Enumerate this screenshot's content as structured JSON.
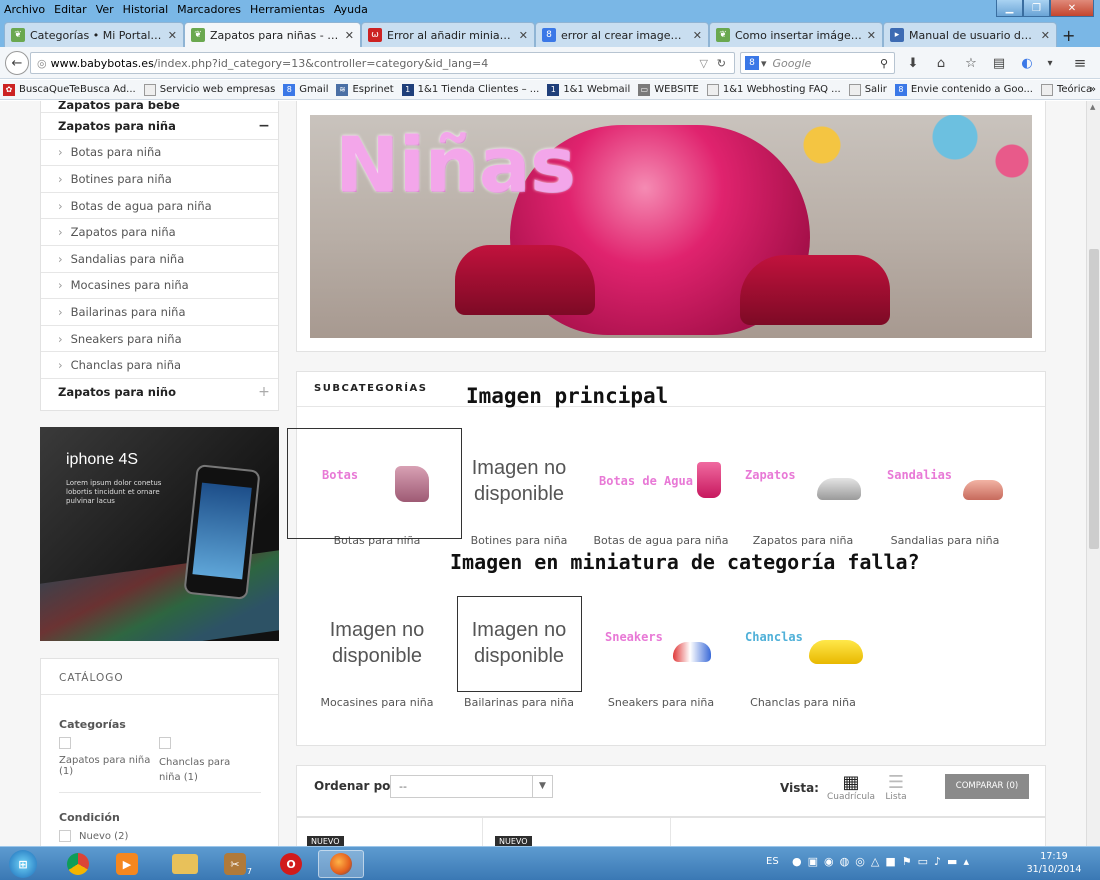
{
  "menubar": {
    "items": [
      "Archivo",
      "Editar",
      "Ver",
      "Historial",
      "Marcadores",
      "Herramientas",
      "Ayuda"
    ]
  },
  "tabs": [
    {
      "title": "Categorías • Mi Portal/C...",
      "favicon": "leaf-icon",
      "color": "#6aa84f"
    },
    {
      "title": "Zapatos para niñas - Mi P...",
      "favicon": "leaf-icon",
      "color": "#6aa84f",
      "active": true
    },
    {
      "title": "Error al añadir miniatura ...",
      "favicon": "u-icon",
      "color": "#cc2222"
    },
    {
      "title": "error al crear imagen sub...",
      "favicon": "google-icon",
      "color": "#3b78e7"
    },
    {
      "title": "Como insertar imágenes ...",
      "favicon": "leaf-icon",
      "color": "#6aa84f"
    },
    {
      "title": "Manual de usuario de Pre...",
      "favicon": "prestashop-icon",
      "color": "#3d6bb3"
    }
  ],
  "navbar": {
    "url_host": "www.babybotas.es",
    "url_path": "/index.php?id_category=13&controller=category&id_lang=4",
    "search_placeholder": "Google"
  },
  "bookmarks": [
    "BuscaQueTeBusca Ad...",
    "Servicio web empresas",
    "Gmail",
    "Esprinet",
    "1&1 Tienda Clientes – ...",
    "1&1 Webmail",
    "WEBSITE",
    "1&1 Webhosting FAQ ...",
    "Salir",
    "Envie contenido a Goo...",
    "Teórica"
  ],
  "sidebar": {
    "top_cut_label": "Zapatos para bebe",
    "current": {
      "label": "Zapatos para niña",
      "toggle": "−"
    },
    "items": [
      "Botas para niña",
      "Botines para niña",
      "Botas de agua para niña",
      "Zapatos para niña",
      "Sandalias para niña",
      "Mocasines para niña",
      "Bailarinas para niña",
      "Sneakers para niña",
      "Chanclas para niña"
    ],
    "next": {
      "label": "Zapatos para niño",
      "toggle": "+"
    },
    "ad": {
      "title": "iphone 4S",
      "text": "Lorem ipsum dolor conetus lobortis tincidunt et ornare pulvinar lacus"
    },
    "catalog": {
      "title": "CATÁLOGO",
      "categories_label": "Categorías",
      "filters": [
        "Zapatos para niña (1)",
        "Chanclas para niña (1)"
      ],
      "condition_label": "Condición",
      "condition_option": "Nuevo (2)"
    }
  },
  "banner": {
    "text": "Niñas"
  },
  "subcategories": {
    "title": "SUBCATEGORÍAS",
    "no_image_text": "Imagen no disponible",
    "row1": [
      {
        "label": "Botas para niña",
        "img_text": "Botas",
        "type": "img"
      },
      {
        "label": "Botines para niña",
        "type": "none"
      },
      {
        "label": "Botas de agua para niña",
        "img_text": "Botas de Agua",
        "type": "img"
      },
      {
        "label": "Zapatos para niña",
        "img_text": "Zapatos",
        "type": "img"
      },
      {
        "label": "Sandalias para niña",
        "img_text": "Sandalias",
        "type": "img"
      }
    ],
    "row2": [
      {
        "label": "Mocasines para niña",
        "type": "none"
      },
      {
        "label": "Bailarinas para niña",
        "type": "none"
      },
      {
        "label": "Sneakers para niña",
        "img_text": "Sneakers",
        "type": "img"
      },
      {
        "label": "Chanclas para niña",
        "img_text": "Chanclas",
        "type": "img"
      }
    ]
  },
  "annotations": {
    "main": "Imagen principal",
    "question": "Imagen en miniatura de categoría falla?"
  },
  "toolbar": {
    "sort_label": "Ordenar por",
    "sort_value": "--",
    "view_label": "Vista:",
    "grid_label": "Cuadrícula",
    "list_label": "Lista",
    "compare_label": "COMPARAR (0)"
  },
  "products": {
    "badge": "NUEVO"
  },
  "taskbar": {
    "lang": "ES",
    "time": "17:19",
    "date": "31/10/2014",
    "counter": "7"
  }
}
